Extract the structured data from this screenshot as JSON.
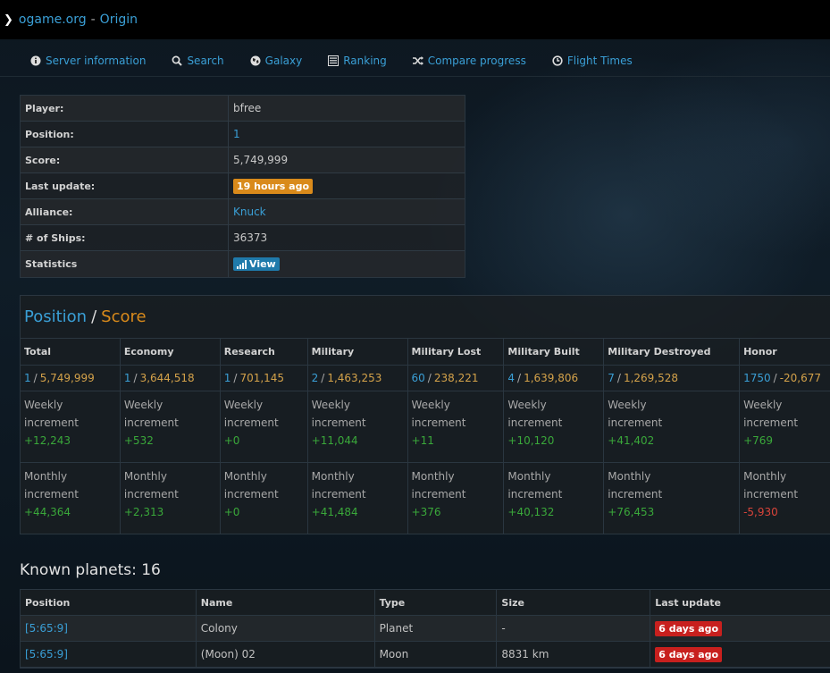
{
  "topbar": {
    "site": "ogame.org",
    "separator": "-",
    "universe": "Origin"
  },
  "nav": [
    {
      "label": "Server information",
      "icon": "info-icon"
    },
    {
      "label": "Search",
      "icon": "search-icon"
    },
    {
      "label": "Galaxy",
      "icon": "globe-icon"
    },
    {
      "label": "Ranking",
      "icon": "list-icon"
    },
    {
      "label": "Compare progress",
      "icon": "shuffle-icon"
    },
    {
      "label": "Flight Times",
      "icon": "clock-icon"
    }
  ],
  "player": {
    "player_label": "Player:",
    "player_value": "bfree",
    "position_label": "Position:",
    "position_value": "1",
    "score_label": "Score:",
    "score_value": "5,749,999",
    "update_label": "Last update:",
    "update_value": "19 hours ago",
    "alliance_label": "Alliance:",
    "alliance_value": "Knuck",
    "ships_label": "# of Ships:",
    "ships_value": "36373",
    "stats_label": "Statistics",
    "stats_button": "View"
  },
  "score_section": {
    "title_position": "Position",
    "title_separator": "/",
    "title_score": "Score",
    "weekly_label_1": "Weekly",
    "weekly_label_2": "increment",
    "monthly_label_1": "Monthly",
    "monthly_label_2": "increment",
    "rank_separator": "/",
    "categories": [
      {
        "name": "Total",
        "rank": "1",
        "score": "5,749,999",
        "weekly": "+12,243",
        "monthly": "+44,364"
      },
      {
        "name": "Economy",
        "rank": "1",
        "score": "3,644,518",
        "weekly": "+532",
        "monthly": "+2,313"
      },
      {
        "name": "Research",
        "rank": "1",
        "score": "701,145",
        "weekly": "+0",
        "monthly": "+0"
      },
      {
        "name": "Military",
        "rank": "2",
        "score": "1,463,253",
        "weekly": "+11,044",
        "monthly": "+41,484"
      },
      {
        "name": "Military Lost",
        "rank": "60",
        "score": "238,221",
        "weekly": "+11",
        "monthly": "+376"
      },
      {
        "name": "Military Built",
        "rank": "4",
        "score": "1,639,806",
        "weekly": "+10,120",
        "monthly": "+40,132"
      },
      {
        "name": "Military Destroyed",
        "rank": "7",
        "score": "1,269,528",
        "weekly": "+41,402",
        "monthly": "+76,453"
      },
      {
        "name": "Honor",
        "rank": "1750",
        "score": "-20,677",
        "weekly": "+769",
        "monthly": "-5,930"
      }
    ]
  },
  "planets": {
    "title": "Known planets: 16",
    "headers": [
      "Position",
      "Name",
      "Type",
      "Size",
      "Last update"
    ],
    "rows": [
      {
        "position": "[5:65:9]",
        "name": "Colony",
        "type": "Planet",
        "size": "-",
        "last_update": "6 days ago"
      },
      {
        "position": "[5:65:9]",
        "name": "(Moon) 02",
        "type": "Moon",
        "size": "8831 km",
        "last_update": "6 days ago"
      }
    ]
  },
  "colors": {
    "link": "#3a9fd6",
    "score_orange": "#d98a1b",
    "positive": "#3aa83a",
    "negative": "#d9443a",
    "badge_red": "#c8201e"
  }
}
